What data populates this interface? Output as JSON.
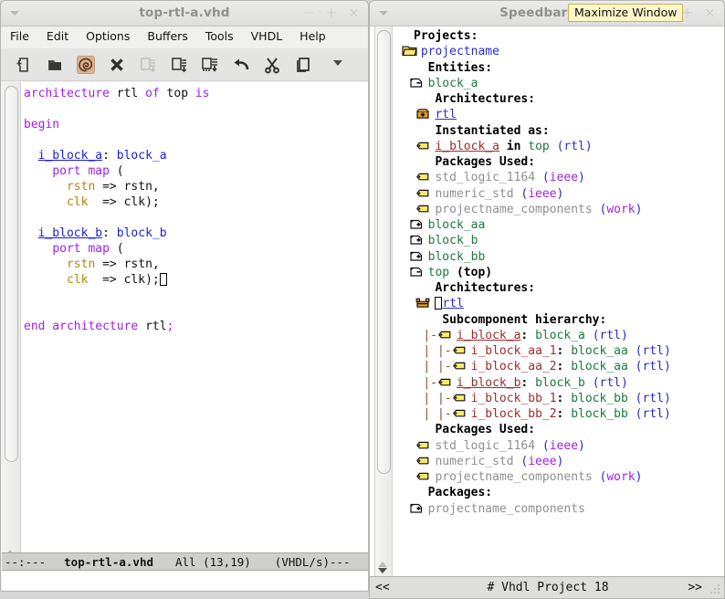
{
  "left_window": {
    "title": "top-rtl-a.vhd",
    "window_controls": [
      "−",
      "+",
      "×"
    ],
    "menu": [
      "File",
      "Edit",
      "Options",
      "Buffers",
      "Tools",
      "VHDL",
      "Help"
    ],
    "toolbar_icons": [
      "new-file-icon",
      "open-folder-icon",
      "save-icon",
      "close-icon",
      "save-as-disabled-icon",
      "save-some-buffers-icon",
      "undo-icon",
      "cut-icon",
      "copy-icon",
      "toolbar-overflow-caret-icon"
    ],
    "code_lines": [
      [
        {
          "t": "architecture ",
          "c": "kw"
        },
        {
          "t": "rtl ",
          "c": "pun"
        },
        {
          "t": "of ",
          "c": "kw"
        },
        {
          "t": "top ",
          "c": "pun"
        },
        {
          "t": "is",
          "c": "kw"
        }
      ],
      [],
      [
        {
          "t": "begin",
          "c": "kw"
        }
      ],
      [],
      [
        {
          "t": "  ",
          "c": "pun"
        },
        {
          "t": "i_block_a",
          "c": "lbl"
        },
        {
          "t": ": ",
          "c": "pun"
        },
        {
          "t": "block_a",
          "c": "typ"
        }
      ],
      [
        {
          "t": "    ",
          "c": "pun"
        },
        {
          "t": "port map",
          "c": "kw"
        },
        {
          "t": " (",
          "c": "pun"
        }
      ],
      [
        {
          "t": "      ",
          "c": "pun"
        },
        {
          "t": "rstn",
          "c": "prt"
        },
        {
          "t": " => rstn,",
          "c": "pun"
        }
      ],
      [
        {
          "t": "      ",
          "c": "pun"
        },
        {
          "t": "clk",
          "c": "prt"
        },
        {
          "t": "  => clk);",
          "c": "pun"
        }
      ],
      [],
      [
        {
          "t": "  ",
          "c": "pun"
        },
        {
          "t": "i_block_b",
          "c": "lbl"
        },
        {
          "t": ": ",
          "c": "pun"
        },
        {
          "t": "block_b",
          "c": "typ"
        }
      ],
      [
        {
          "t": "    ",
          "c": "pun"
        },
        {
          "t": "port map",
          "c": "kw"
        },
        {
          "t": " (",
          "c": "pun"
        }
      ],
      [
        {
          "t": "      ",
          "c": "pun"
        },
        {
          "t": "rstn",
          "c": "prt"
        },
        {
          "t": " => rstn,",
          "c": "pun"
        }
      ],
      [
        {
          "t": "      ",
          "c": "pun"
        },
        {
          "t": "clk",
          "c": "prt"
        },
        {
          "t": "  => clk);",
          "c": "pun"
        },
        {
          "t": "CURSOR",
          "c": "cursor"
        }
      ],
      [],
      [],
      [
        {
          "t": "end architecture ",
          "c": "kw"
        },
        {
          "t": "rtl",
          "c": "pun"
        },
        {
          "t": ";",
          "c": "kw"
        }
      ]
    ],
    "modeline": {
      "prefix": "--:---",
      "buffer_name": "top-rtl-a.vhd",
      "position": "All (13,19)",
      "major_mode": "(VHDL/s)---"
    }
  },
  "right_window": {
    "title": "Speedbar 1.0",
    "window_controls": [
      "+",
      "×"
    ],
    "tooltip": "Maximize Window",
    "tree": [
      {
        "indent": 0,
        "icon": "none",
        "parts": [
          {
            "t": "Projects:",
            "c": "t-plain"
          }
        ]
      },
      {
        "indent": 1,
        "icon": "folder-open-icon",
        "parts": [
          {
            "t": "projectname",
            "c": "t-proj"
          }
        ]
      },
      {
        "indent": 2,
        "icon": "none",
        "parts": [
          {
            "t": "Entities:",
            "c": "t-plain"
          }
        ]
      },
      {
        "indent": 2,
        "icon": "page-minus-icon",
        "parts": [
          {
            "t": "block_a",
            "c": "t-ent"
          }
        ]
      },
      {
        "indent": 3,
        "icon": "none",
        "parts": [
          {
            "t": "Architectures:",
            "c": "t-plain"
          }
        ]
      },
      {
        "indent": 3,
        "icon": "box-plus-icon",
        "parts": [
          {
            "t": "rtl",
            "c": "t-arch"
          }
        ]
      },
      {
        "indent": 3,
        "icon": "none",
        "parts": [
          {
            "t": "Instantiated as:",
            "c": "t-plain"
          }
        ]
      },
      {
        "indent": 3,
        "icon": "tag-icon",
        "parts": [
          {
            "t": "i_block_a",
            "c": "t-inst"
          },
          {
            "t": " in ",
            "c": "t-plain"
          },
          {
            "t": "top",
            "c": "t-ent"
          },
          {
            "t": " ",
            "c": "t-plain"
          },
          {
            "t": "(rtl)",
            "c": "t-paren"
          }
        ]
      },
      {
        "indent": 3,
        "icon": "none",
        "parts": [
          {
            "t": "Packages Used:",
            "c": "t-plain"
          }
        ]
      },
      {
        "indent": 3,
        "icon": "tag-icon",
        "parts": [
          {
            "t": "std_logic_1164",
            "c": "t-pkg"
          },
          {
            "t": " ",
            "c": "t-plain"
          },
          {
            "t": "(",
            "c": "t-paren"
          },
          {
            "t": "ieee",
            "c": "t-lib"
          },
          {
            "t": ")",
            "c": "t-paren"
          }
        ]
      },
      {
        "indent": 3,
        "icon": "tag-icon",
        "parts": [
          {
            "t": "numeric_std",
            "c": "t-pkg"
          },
          {
            "t": " ",
            "c": "t-plain"
          },
          {
            "t": "(",
            "c": "t-paren"
          },
          {
            "t": "ieee",
            "c": "t-lib"
          },
          {
            "t": ")",
            "c": "t-paren"
          }
        ]
      },
      {
        "indent": 3,
        "icon": "tag-icon",
        "parts": [
          {
            "t": "projectname_components",
            "c": "t-pkg"
          },
          {
            "t": " ",
            "c": "t-plain"
          },
          {
            "t": "(",
            "c": "t-paren"
          },
          {
            "t": "work",
            "c": "t-lib"
          },
          {
            "t": ")",
            "c": "t-paren"
          }
        ]
      },
      {
        "indent": 2,
        "icon": "page-plus-icon",
        "parts": [
          {
            "t": "block_aa",
            "c": "t-ent"
          }
        ]
      },
      {
        "indent": 2,
        "icon": "page-plus-icon",
        "parts": [
          {
            "t": "block_b",
            "c": "t-ent"
          }
        ]
      },
      {
        "indent": 2,
        "icon": "page-plus-icon",
        "parts": [
          {
            "t": "block_bb",
            "c": "t-ent"
          }
        ]
      },
      {
        "indent": 2,
        "icon": "page-minus-icon",
        "parts": [
          {
            "t": "top",
            "c": "t-ent"
          },
          {
            "t": " ",
            "c": "t-plain"
          },
          {
            "t": "(top)",
            "c": "t-plain"
          }
        ]
      },
      {
        "indent": 3,
        "icon": "none",
        "parts": [
          {
            "t": "Architectures:",
            "c": "t-plain"
          }
        ]
      },
      {
        "indent": 3,
        "icon": "box-open-icon",
        "parts": [
          {
            "t": "CURSOR",
            "c": "cursor"
          },
          {
            "t": "rtl",
            "c": "t-arch"
          }
        ]
      },
      {
        "indent": 4,
        "icon": "none",
        "parts": [
          {
            "t": "Subcomponent hierarchy:",
            "c": "t-plain"
          }
        ]
      },
      {
        "indent": 4,
        "icon": "tag-icon",
        "guide": "|-",
        "parts": [
          {
            "t": "i_block_a",
            "c": "t-inst"
          },
          {
            "t": ": ",
            "c": "t-plain"
          },
          {
            "t": "block_a",
            "c": "t-ent"
          },
          {
            "t": " ",
            "c": "t-plain"
          },
          {
            "t": "(rtl)",
            "c": "t-paren"
          }
        ]
      },
      {
        "indent": 4,
        "icon": "tag-icon",
        "guide": "| |-",
        "parts": [
          {
            "t": "i_block_aa_1",
            "c": "t-inst2"
          },
          {
            "t": ": ",
            "c": "t-plain"
          },
          {
            "t": "block_aa",
            "c": "t-ent"
          },
          {
            "t": " ",
            "c": "t-plain"
          },
          {
            "t": "(rtl)",
            "c": "t-paren"
          }
        ]
      },
      {
        "indent": 4,
        "icon": "tag-icon",
        "guide": "| |-",
        "parts": [
          {
            "t": "i_block_aa_2",
            "c": "t-inst2"
          },
          {
            "t": ": ",
            "c": "t-plain"
          },
          {
            "t": "block_aa",
            "c": "t-ent"
          },
          {
            "t": " ",
            "c": "t-plain"
          },
          {
            "t": "(rtl)",
            "c": "t-paren"
          }
        ]
      },
      {
        "indent": 4,
        "icon": "tag-icon",
        "guide": "|-",
        "parts": [
          {
            "t": "i_block_b",
            "c": "t-inst"
          },
          {
            "t": ": ",
            "c": "t-plain"
          },
          {
            "t": "block_b",
            "c": "t-ent"
          },
          {
            "t": " ",
            "c": "t-plain"
          },
          {
            "t": "(rtl)",
            "c": "t-paren"
          }
        ]
      },
      {
        "indent": 4,
        "icon": "tag-icon",
        "guide": "| |-",
        "parts": [
          {
            "t": "i_block_bb_1",
            "c": "t-inst2"
          },
          {
            "t": ": ",
            "c": "t-plain"
          },
          {
            "t": "block_bb",
            "c": "t-ent"
          },
          {
            "t": " ",
            "c": "t-plain"
          },
          {
            "t": "(rtl)",
            "c": "t-paren"
          }
        ]
      },
      {
        "indent": 4,
        "icon": "tag-icon",
        "guide": "| |-",
        "parts": [
          {
            "t": "i_block_bb_2",
            "c": "t-inst2"
          },
          {
            "t": ": ",
            "c": "t-plain"
          },
          {
            "t": "block_bb",
            "c": "t-ent"
          },
          {
            "t": " ",
            "c": "t-plain"
          },
          {
            "t": "(rtl)",
            "c": "t-paren"
          }
        ]
      },
      {
        "indent": 3,
        "icon": "none",
        "parts": [
          {
            "t": "Packages Used:",
            "c": "t-plain"
          }
        ]
      },
      {
        "indent": 3,
        "icon": "tag-icon",
        "parts": [
          {
            "t": "std_logic_1164",
            "c": "t-pkg"
          },
          {
            "t": " ",
            "c": "t-plain"
          },
          {
            "t": "(",
            "c": "t-paren"
          },
          {
            "t": "ieee",
            "c": "t-lib"
          },
          {
            "t": ")",
            "c": "t-paren"
          }
        ]
      },
      {
        "indent": 3,
        "icon": "tag-icon",
        "parts": [
          {
            "t": "numeric_std",
            "c": "t-pkg"
          },
          {
            "t": " ",
            "c": "t-plain"
          },
          {
            "t": "(",
            "c": "t-paren"
          },
          {
            "t": "ieee",
            "c": "t-lib"
          },
          {
            "t": ")",
            "c": "t-paren"
          }
        ]
      },
      {
        "indent": 3,
        "icon": "tag-icon",
        "parts": [
          {
            "t": "projectname_components",
            "c": "t-pkg"
          },
          {
            "t": " ",
            "c": "t-plain"
          },
          {
            "t": "(",
            "c": "t-paren"
          },
          {
            "t": "work",
            "c": "t-lib"
          },
          {
            "t": ")",
            "c": "t-paren"
          }
        ]
      },
      {
        "indent": 2,
        "icon": "none",
        "parts": [
          {
            "t": "Packages:",
            "c": "t-plain"
          }
        ]
      },
      {
        "indent": 2,
        "icon": "page-plus-icon",
        "parts": [
          {
            "t": "projectname_components",
            "c": "t-pkg"
          }
        ]
      }
    ],
    "status": {
      "left": "<<",
      "center": "# Vhdl Project  18",
      "right": ">>"
    }
  },
  "colors": {
    "keyword_purple": "#a020f0",
    "entity_green": "#1a7a3c",
    "instance_red": "#9b2d2d",
    "link_blue": "#2b2bcf",
    "package_gray": "#8f8f8f",
    "tooltip_bg": "#fdf6c8"
  }
}
